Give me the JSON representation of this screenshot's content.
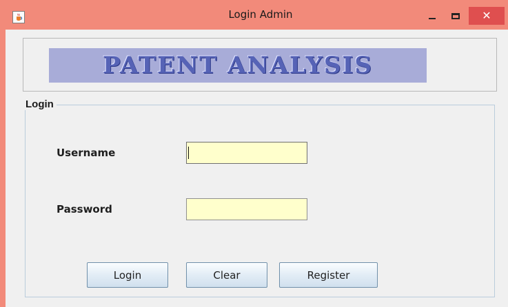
{
  "window": {
    "title": "Login Admin",
    "titlebar_color": "#f28a7a",
    "close_button_color": "#df4f4f"
  },
  "icons": {
    "app": "java-cup-icon",
    "minimize": "minimize-icon",
    "maximize": "maximize-icon",
    "close": "close-icon"
  },
  "banner": {
    "text": "PATENT ANALYSIS",
    "background_color": "#a8acd8",
    "text_color": "#5663b6"
  },
  "login_panel": {
    "legend": "Login",
    "username_label": "Username",
    "password_label": "Password",
    "username_value": "",
    "password_value": "",
    "input_background": "#ffffcc"
  },
  "buttons": {
    "login": "Login",
    "clear": "Clear",
    "register": "Register"
  }
}
